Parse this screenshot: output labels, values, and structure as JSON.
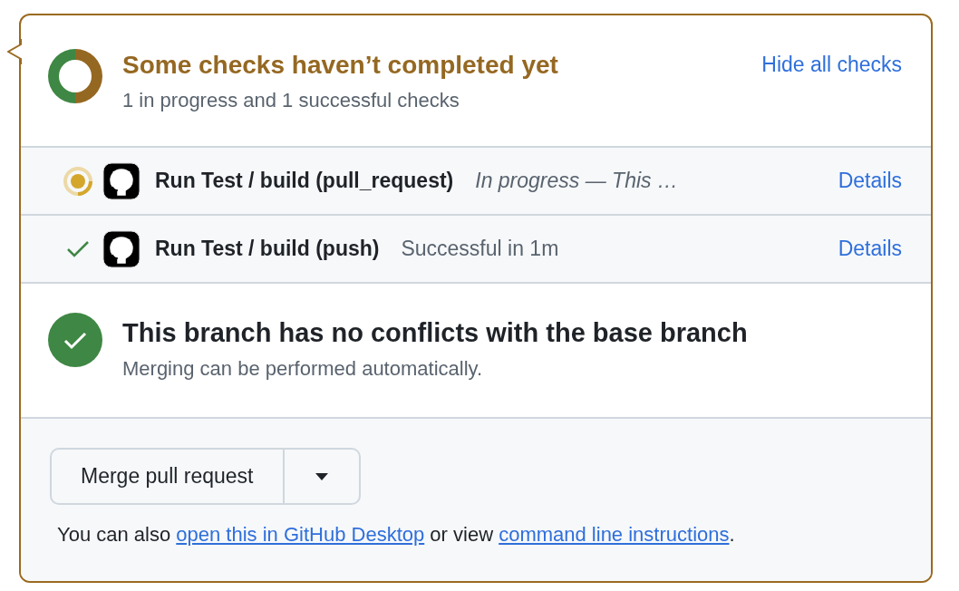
{
  "summary": {
    "title": "Some checks haven’t completed yet",
    "subtitle": "1 in progress and 1 successful checks",
    "toggle": "Hide all checks"
  },
  "checks": [
    {
      "kind": "progress",
      "name": "Run Test / build (pull_request)",
      "description": "In progress — This …",
      "italic": true,
      "link": "Details"
    },
    {
      "kind": "success",
      "name": "Run Test / build (push)",
      "description": "Successful in 1m",
      "italic": false,
      "link": "Details"
    }
  ],
  "merge_status": {
    "title": "This branch has no conflicts with the base branch",
    "subtitle": "Merging can be performed automatically."
  },
  "merge_button": {
    "label": "Merge pull request"
  },
  "footer": [
    {
      "kind": "text",
      "text": "You can also "
    },
    {
      "kind": "link",
      "text": "open this in GitHub Desktop"
    },
    {
      "kind": "text",
      "text": " or view "
    },
    {
      "kind": "link",
      "text": "command line instructions"
    },
    {
      "kind": "text",
      "text": "."
    }
  ]
}
